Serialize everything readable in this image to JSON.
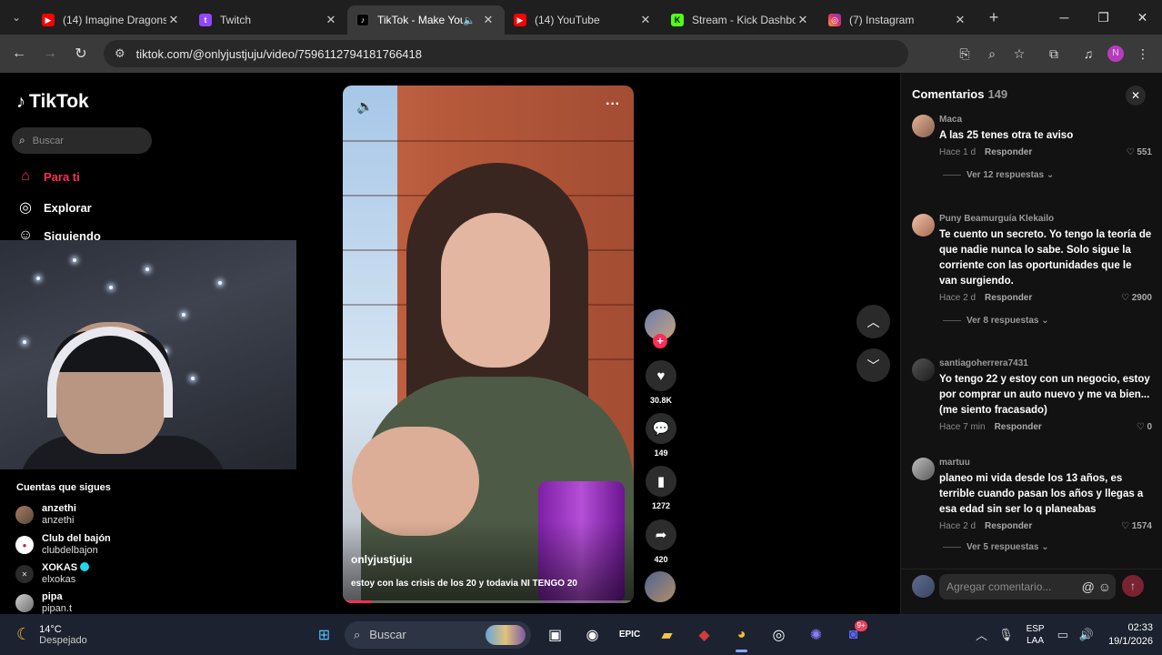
{
  "browser": {
    "tabs": [
      {
        "title": "(14) Imagine Dragons",
        "favicon": "youtube-icon",
        "color": "#ff0000",
        "active": false
      },
      {
        "title": "Twitch",
        "favicon": "twitch-icon",
        "color": "#9146ff",
        "active": false
      },
      {
        "title": "TikTok - Make Your",
        "favicon": "tiktok-icon",
        "color": "#000000",
        "active": true,
        "audio": true
      },
      {
        "title": "(14) YouTube",
        "favicon": "youtube-icon",
        "color": "#ff0000",
        "active": false
      },
      {
        "title": "Stream - Kick Dashbo",
        "favicon": "kick-icon",
        "color": "#53fc18",
        "active": false
      },
      {
        "title": "(7) Instagram",
        "favicon": "instagram-icon",
        "color": "#e1306c",
        "active": false
      }
    ],
    "url": "tiktok.com/@onlyjustjuju/video/7596112794181766418",
    "profile_initial": "N"
  },
  "sidebar": {
    "logo": "TikTok",
    "search_placeholder": "Buscar",
    "menu": [
      {
        "label": "Para ti",
        "icon": "home-icon",
        "active": true
      },
      {
        "label": "Explorar",
        "icon": "compass-icon",
        "active": false
      },
      {
        "label": "Siguiendo",
        "icon": "following-icon",
        "active": false
      }
    ],
    "following_title": "Cuentas que sigues",
    "following": [
      {
        "name": "anzethi",
        "handle": "anzethi",
        "verified": false
      },
      {
        "name": "Club del bajón",
        "handle": "clubdelbajon",
        "verified": false
      },
      {
        "name": "XOKAS",
        "handle": "elxokas",
        "verified": true
      },
      {
        "name": "pipa",
        "handle": "pipan.t",
        "verified": false
      }
    ]
  },
  "video": {
    "username": "onlyjustjuju",
    "caption": "estoy con las crisis de los 20 y todavia NI TENGO 20",
    "progress": 0.1
  },
  "actions": {
    "likes": "30.8K",
    "comments": "149",
    "saves": "1272",
    "shares": "420"
  },
  "comments_panel": {
    "title": "Comentarios",
    "count": "149",
    "input_placeholder": "Agregar comentario...",
    "items": [
      {
        "user": "Maca",
        "text": "A las 25 tenes otra te aviso",
        "time": "Hace 1 d",
        "reply": "Responder",
        "likes": "551",
        "more": "Ver 12 respuestas"
      },
      {
        "user": "Puny Beamurguía Klekailo",
        "text": "Te cuento un secreto. Yo tengo la teoría de que nadie nunca lo sabe. Solo sigue la corriente con las oportunidades que le van surgiendo.",
        "time": "Hace 2 d",
        "reply": "Responder",
        "likes": "2900",
        "more": "Ver 8 respuestas"
      },
      {
        "user": "santiagoherrera7431",
        "text": "Yo tengo 22 y estoy con un negocio, estoy por comprar un auto nuevo y me va bien... (me siento fracasado)",
        "time": "Hace 7 min",
        "reply": "Responder",
        "likes": "0",
        "more": ""
      },
      {
        "user": "martuu",
        "text": "planeo mi vida desde los 13 años, es terrible cuando pasan los años y llegas a esa edad sin ser lo q planeabas",
        "time": "Hace 2 d",
        "reply": "Responder",
        "likes": "1574",
        "more": "Ver 5 respuestas"
      }
    ]
  },
  "taskbar": {
    "temp": "14°C",
    "weather": "Despejado",
    "search": "Buscar",
    "lang1": "ESP",
    "lang2": "LAA",
    "time": "02:33",
    "date": "19/1/2026",
    "discord_badge": "9+"
  }
}
